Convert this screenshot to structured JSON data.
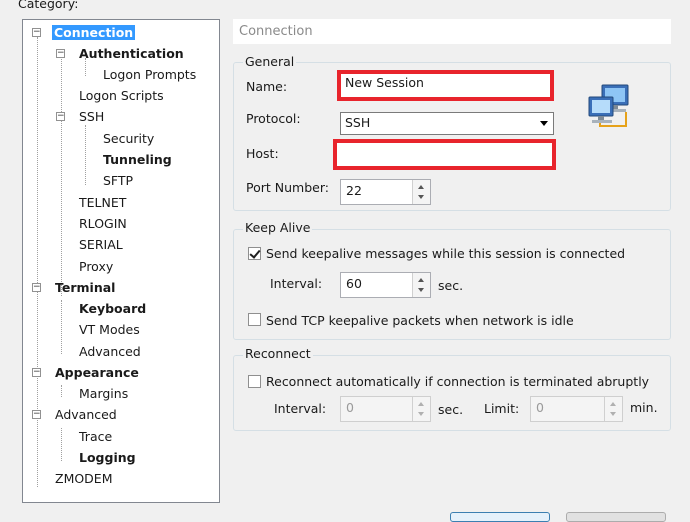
{
  "category_label": "Category:",
  "tree": {
    "connection": "Connection",
    "authentication": "Authentication",
    "logon_prompts": "Logon Prompts",
    "logon_scripts": "Logon Scripts",
    "ssh": "SSH",
    "security": "Security",
    "tunneling": "Tunneling",
    "sftp": "SFTP",
    "telnet": "TELNET",
    "rlogin": "RLOGIN",
    "serial": "SERIAL",
    "proxy": "Proxy",
    "terminal": "Terminal",
    "keyboard": "Keyboard",
    "vt_modes": "VT Modes",
    "advanced_term": "Advanced",
    "appearance": "Appearance",
    "margins": "Margins",
    "advanced": "Advanced",
    "trace": "Trace",
    "logging": "Logging",
    "zmodem": "ZMODEM"
  },
  "header": {
    "title": "Connection"
  },
  "general": {
    "title": "General",
    "name_label": "Name:",
    "name_value": "New Session",
    "protocol_label": "Protocol:",
    "protocol_value": "SSH",
    "host_label": "Host:",
    "host_value": "",
    "port_label": "Port Number:",
    "port_value": "22"
  },
  "keep_alive": {
    "title": "Keep Alive",
    "send_keepalive_label": "Send keepalive messages while this session is connected",
    "send_keepalive_checked": true,
    "interval_label": "Interval:",
    "interval_value": "60",
    "interval_unit": "sec.",
    "tcp_keepalive_label": "Send TCP keepalive packets when network is idle",
    "tcp_keepalive_checked": false
  },
  "reconnect": {
    "title": "Reconnect",
    "auto_label": "Reconnect automatically if connection is terminated abruptly",
    "auto_checked": false,
    "interval_label": "Interval:",
    "interval_value": "0",
    "interval_unit": "sec.",
    "limit_label": "Limit:",
    "limit_value": "0",
    "limit_unit": "min."
  },
  "colors": {
    "highlight_border": "#e8242c",
    "selection": "#3399ff"
  }
}
